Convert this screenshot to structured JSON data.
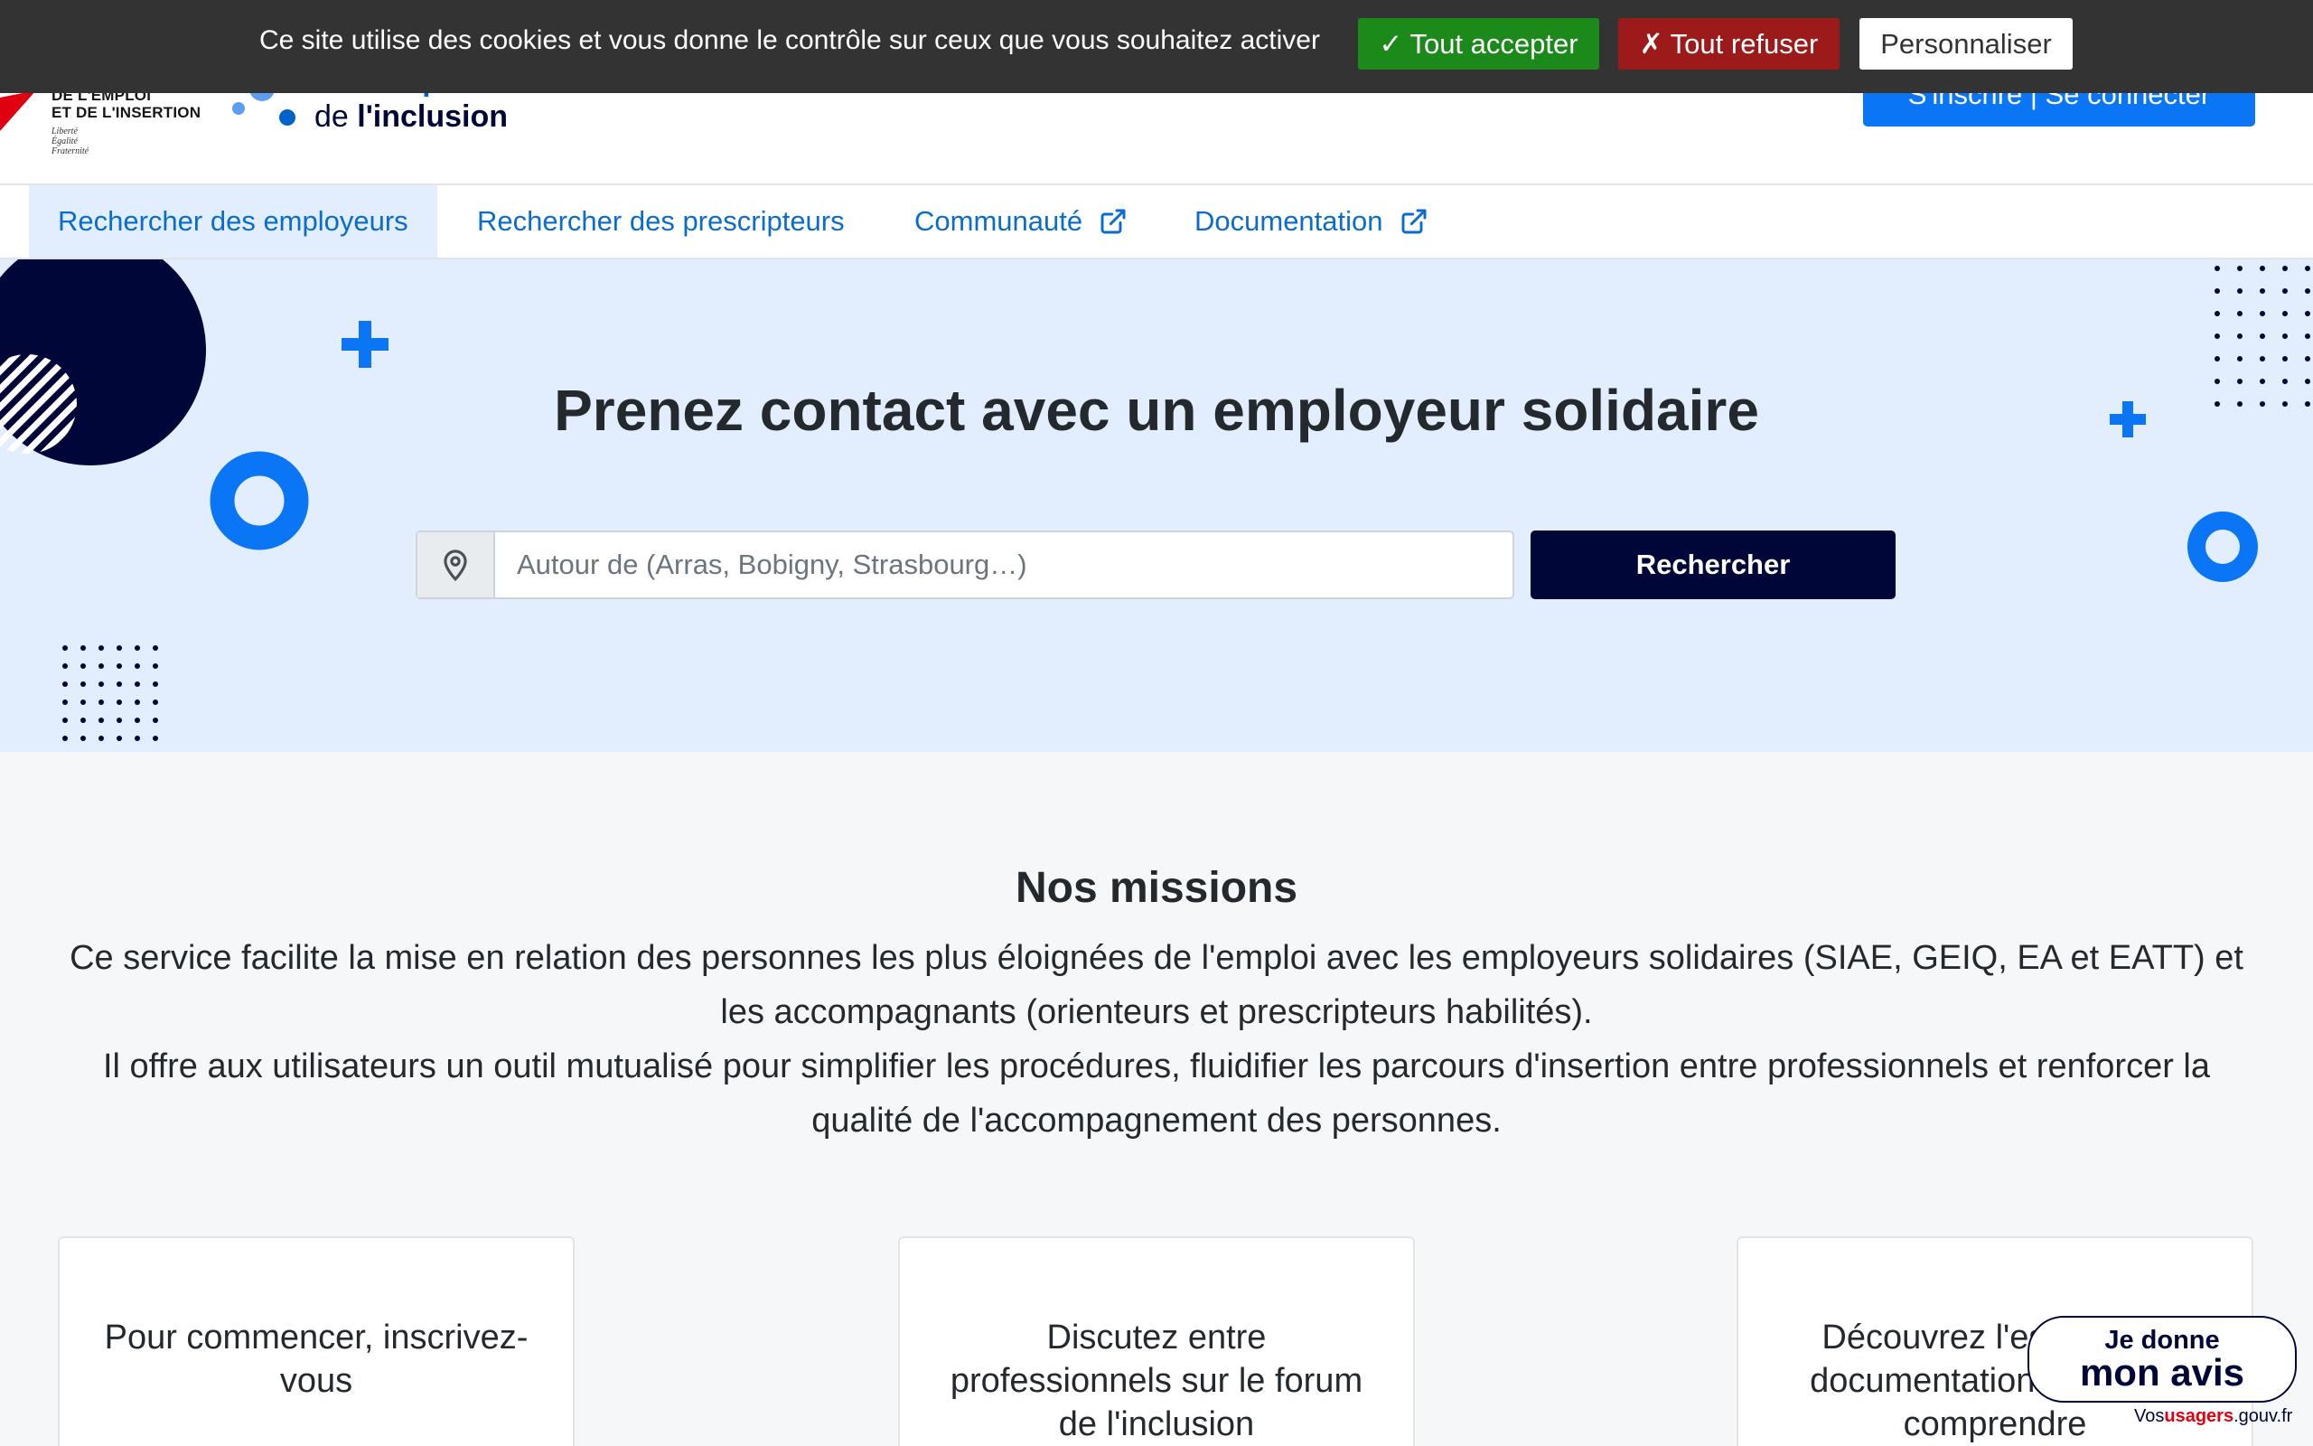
{
  "cookie_banner": {
    "message": "Ce site utilise des cookies et vous donne le contrôle sur ceux que vous souhaitez activer",
    "accept_label": "✓ Tout accepter",
    "refuse_label": "✗ Tout refuser",
    "customize_label": "Personnaliser",
    "accept_color": "#1b8a1b",
    "refuse_color": "#9c1a1a"
  },
  "header": {
    "ministry_line1": "DE L'EMPLOI",
    "ministry_line2": "ET DE L'INSERTION",
    "motto_1": "Liberté",
    "motto_2": "Égalité",
    "motto_3": "Fraternité",
    "brand_top": "Les emplois",
    "brand_prefix": "de ",
    "brand_name": "l'inclusion",
    "login_label": "S'inscrire | Se connecter",
    "login_color": "#0a76f6"
  },
  "nav": {
    "items": [
      {
        "label": "Rechercher des employeurs",
        "active": true
      },
      {
        "label": "Rechercher des prescripteurs"
      },
      {
        "label": "Communauté",
        "icon": "external-link-icon"
      },
      {
        "label": "Documentation",
        "icon": "external-link-icon"
      }
    ]
  },
  "hero": {
    "title": "Prenez contact avec un employeur solidaire",
    "search_icon": "map-pin-icon",
    "search_placeholder": "Autour de (Arras, Bobigny, Strasbourg…)",
    "search_button": "Rechercher",
    "background": "#e2eefd",
    "dark_color": "#000638",
    "accent_color": "#0a76f6"
  },
  "missions": {
    "title": "Nos missions",
    "paragraph_1": "Ce service facilite la mise en relation des personnes les plus éloignées de l'emploi avec les employeurs solidaires (SIAE, GEIQ, EA et EATT) et les accompagnants (orienteurs et prescripteurs habilités).",
    "paragraph_2": "Il offre aux utilisateurs un outil mutualisé pour simplifier les procédures, fluidifier les parcours d'insertion entre professionnels et renforcer la qualité de l'accompagnement des personnes."
  },
  "cards": [
    {
      "text": "Pour commencer, inscrivez-vous"
    },
    {
      "text": "Discutez entre professionnels sur le forum de l'inclusion"
    },
    {
      "text": "Découvrez l'espace de documentation pour tout comprendre"
    }
  ],
  "feedback_badge": {
    "line1": "Je donne",
    "line2": "mon avis",
    "url_prefix": "Vos",
    "url_bold": "usagers",
    "url_suffix": ".gouv.fr"
  }
}
